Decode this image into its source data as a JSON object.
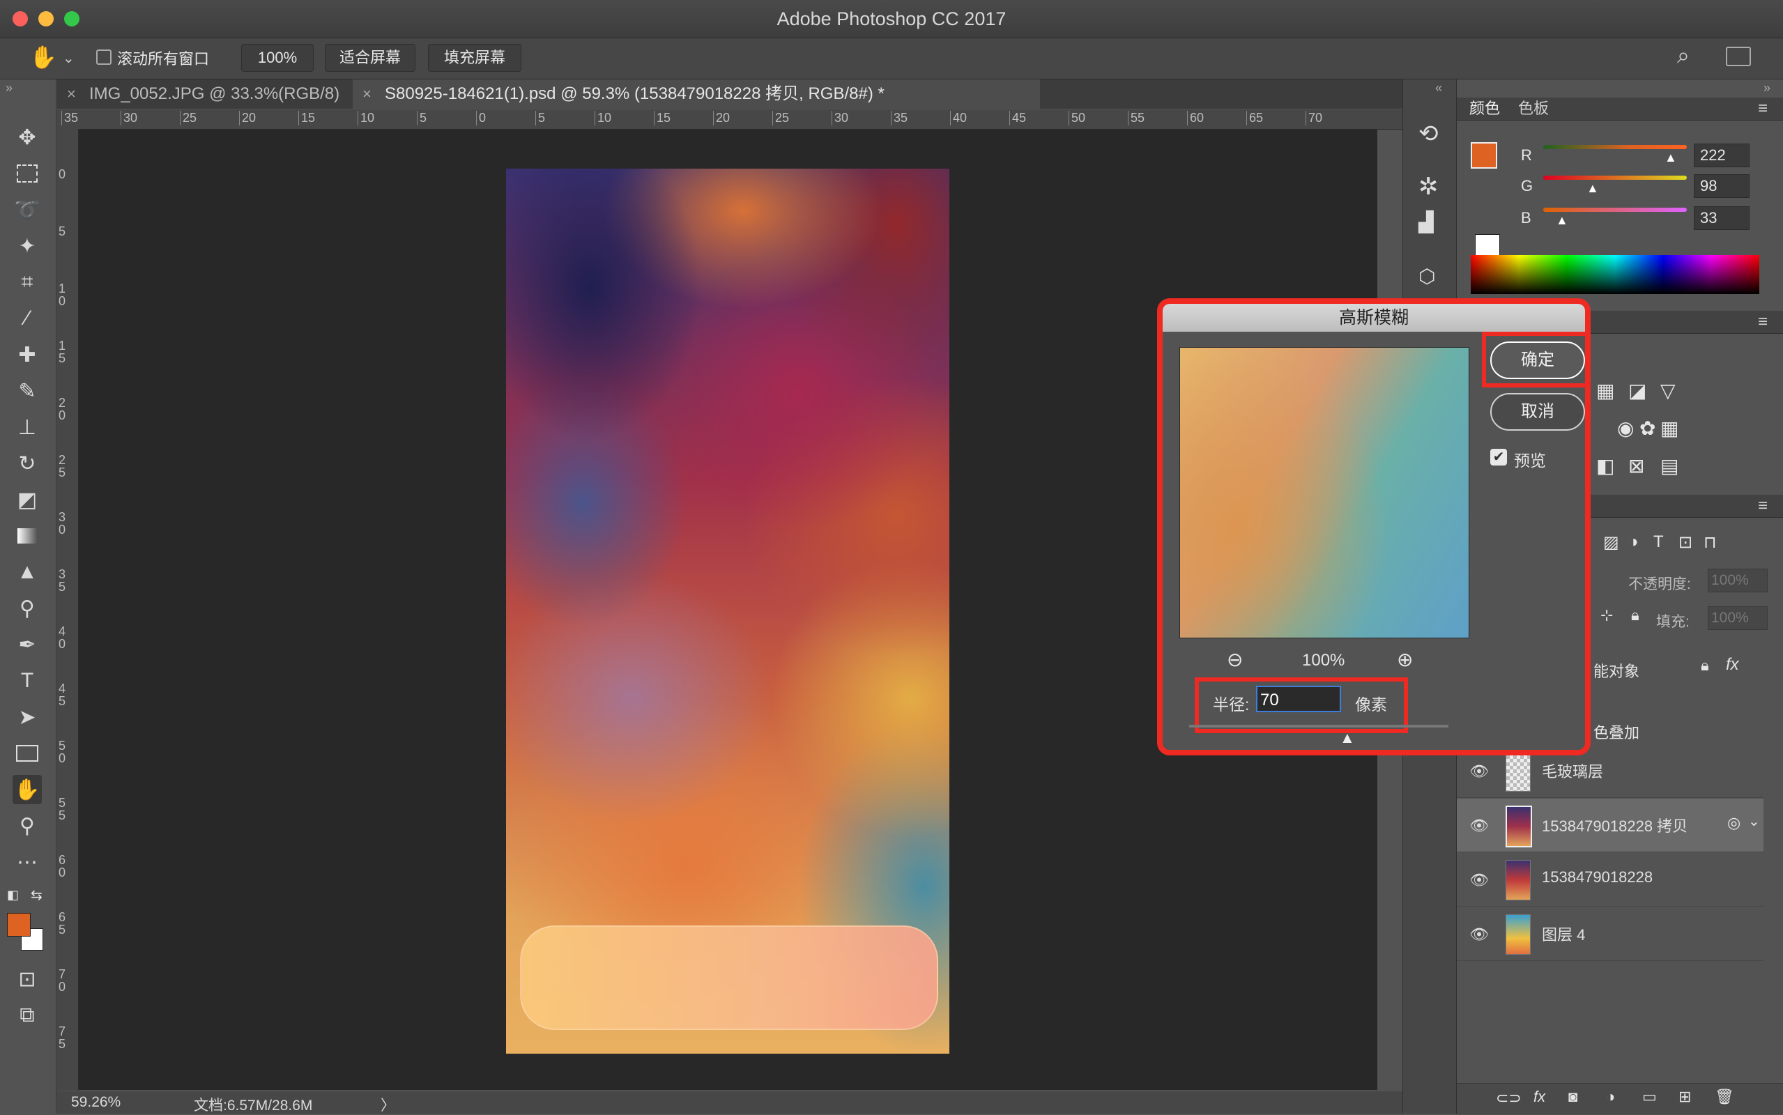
{
  "window": {
    "title": "Adobe Photoshop CC 2017"
  },
  "options_bar": {
    "scroll_all_windows": "滚动所有窗口",
    "zoom_value": "100%",
    "fit_screen": "适合屏幕",
    "fill_screen": "填充屏幕"
  },
  "tabs": [
    {
      "label": "IMG_0052.JPG @ 33.3%(RGB/8)"
    },
    {
      "label": "S80925-184621(1).psd @ 59.3% (1538479018228 拷贝, RGB/8#) *"
    }
  ],
  "ruler": {
    "h_ticks": [
      "35",
      "30",
      "25",
      "20",
      "15",
      "10",
      "5",
      "0",
      "5",
      "10",
      "15",
      "20",
      "25",
      "30",
      "35",
      "40",
      "45",
      "50",
      "55",
      "60",
      "65",
      "70"
    ],
    "v_ticks": [
      "0",
      "5",
      "1 0",
      "1 5",
      "2 0",
      "2 5",
      "3 0",
      "3 5",
      "4 0",
      "4 5",
      "5 0",
      "5 5",
      "6 0",
      "6 5",
      "7 0",
      "7 5"
    ]
  },
  "status": {
    "zoom": "59.26%",
    "doc": "文档:6.57M/28.6M",
    "arrow": "〉"
  },
  "color_panel": {
    "tabs": [
      "颜色",
      "色板"
    ],
    "fg_color": "#de6221",
    "channels": [
      {
        "label": "R",
        "value": "222",
        "fraction": 0.87
      },
      {
        "label": "G",
        "value": "98",
        "fraction": 0.38
      },
      {
        "label": "B",
        "value": "33",
        "fraction": 0.13
      }
    ]
  },
  "layers_panel": {
    "opacity_label": "不透明度:",
    "opacity_value": "100%",
    "fill_label": "填充:",
    "fill_value": "100%",
    "smart_object": "能对象",
    "color_overlay": "色叠加",
    "layers": [
      {
        "name": "毛玻璃层"
      },
      {
        "name": "1538479018228 拷贝"
      },
      {
        "name": "1538479018228"
      },
      {
        "name": "图层 4"
      }
    ]
  },
  "dialog": {
    "title": "高斯模糊",
    "ok": "确定",
    "cancel": "取消",
    "preview_label": "预览",
    "zoom": "100%",
    "radius_label": "半径:",
    "radius_value": "70",
    "radius_unit": "像素"
  }
}
